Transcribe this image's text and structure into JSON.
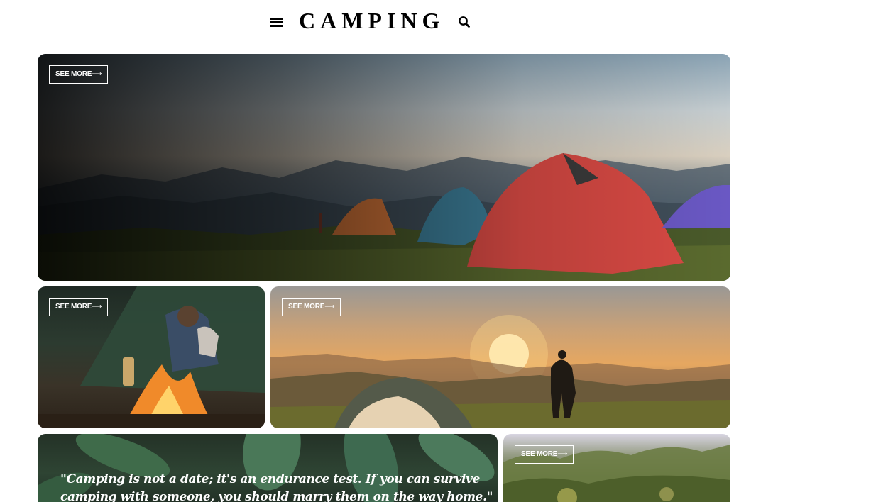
{
  "header": {
    "logo": "CAMPING",
    "menu_icon": "hamburger-menu-icon",
    "search_icon": "search-icon"
  },
  "cards": [
    {
      "see_more": "SEE MORE",
      "arrow": "⟶"
    },
    {
      "see_more": "SEE MORE",
      "arrow": "⟶"
    },
    {
      "see_more": "SEE MORE",
      "arrow": "⟶"
    },
    {
      "quote": "\"Camping is not a date; it's an endurance test. If you can survive camping with someone, you should marry them on the way home.\""
    },
    {
      "see_more": "SEE MORE",
      "arrow": "⟶"
    }
  ]
}
